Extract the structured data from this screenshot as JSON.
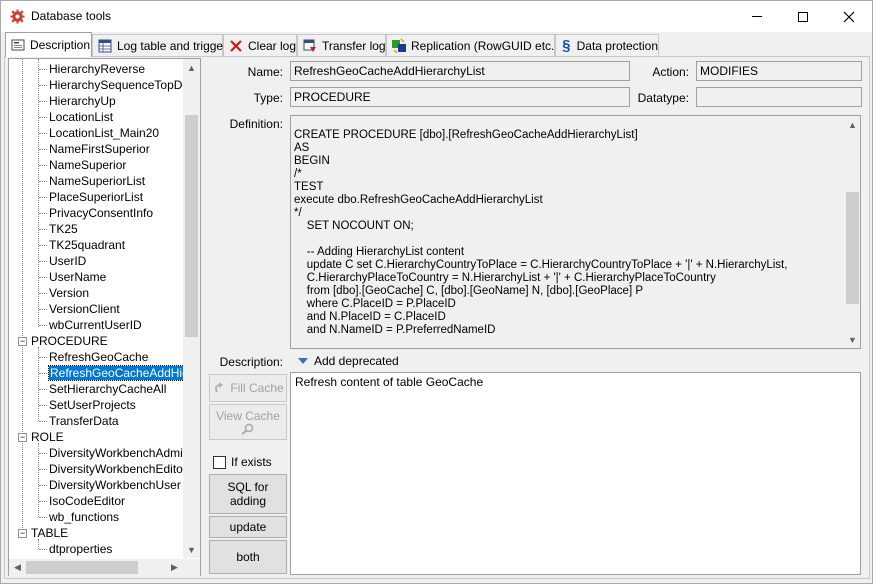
{
  "window": {
    "title": "Database tools",
    "minimize": "—",
    "maximize": "☐",
    "close": "✕"
  },
  "tabs": [
    {
      "label": "Description",
      "icon": "description-icon"
    },
    {
      "label": "Log table and trigger",
      "icon": "log-table-icon"
    },
    {
      "label": "Clear log",
      "icon": "clear-log-icon"
    },
    {
      "label": "Transfer log",
      "icon": "transfer-log-icon"
    },
    {
      "label": "Replication (RowGUID etc.)",
      "icon": "replication-icon"
    },
    {
      "label": "Data protection",
      "icon": "paragraph-icon",
      "glyph": "§"
    }
  ],
  "tree": {
    "functions": [
      "HierarchyReverse",
      "HierarchySequenceTopDow",
      "HierarchyUp",
      "LocationList",
      "LocationList_Main20",
      "NameFirstSuperior",
      "NameSuperior",
      "NameSuperiorList",
      "PlaceSuperiorList",
      "PrivacyConsentInfo",
      "TK25",
      "TK25quadrant",
      "UserID",
      "UserName",
      "Version",
      "VersionClient",
      "wbCurrentUserID"
    ],
    "procedure_label": "PROCEDURE",
    "procedures": [
      "RefreshGeoCache",
      "RefreshGeoCacheAddHiera",
      "SetHierarchyCacheAll",
      "SetUserProjects",
      "TransferData"
    ],
    "role_label": "ROLE",
    "roles": [
      "DiversityWorkbenchAdminist",
      "DiversityWorkbenchEditor",
      "DiversityWorkbenchUser",
      "IsoCodeEditor",
      "wb_functions"
    ],
    "table_label": "TABLE",
    "tables": [
      "dtproperties"
    ],
    "expander_minus": "−"
  },
  "form": {
    "name_label": "Name:",
    "name_value": "RefreshGeoCacheAddHierarchyList",
    "action_label": "Action:",
    "action_value": "MODIFIES",
    "type_label": "Type:",
    "type_value": "PROCEDURE",
    "datatype_label": "Datatype:",
    "datatype_value": "",
    "definition_label": "Definition:",
    "definition_text": "CREATE PROCEDURE [dbo].[RefreshGeoCacheAddHierarchyList]\nAS\nBEGIN\n/*\nTEST\nexecute dbo.RefreshGeoCacheAddHierarchyList\n*/\n    SET NOCOUNT ON;\n\n    -- Adding HierarchyList content\n    update C set C.HierarchyCountryToPlace = C.HierarchyCountryToPlace + '|' + N.HierarchyList,\n    C.HierarchyPlaceToCountry = N.HierarchyList + '|' + C.HierarchyPlaceToCountry\n    from [dbo].[GeoCache] C, [dbo].[GeoName] N, [dbo].[GeoPlace] P\n    where C.PlaceID = P.PlaceID\n    and N.PlaceID = C.PlaceID\n    and N.NameID = P.PreferredNameID",
    "description_label": "Description:",
    "add_deprecated": "Add deprecated",
    "description_text": "Refresh content of table GeoCache"
  },
  "buttons": {
    "fill_cache": "Fill Cache",
    "view_cache": "View Cache",
    "if_exists": "If exists",
    "sql_for_adding_1": "SQL for",
    "sql_for_adding_2": "adding",
    "update": "update",
    "both": "both"
  },
  "colors": {
    "selection": "#0078d7",
    "accent_blue": "#3a6fc4"
  }
}
